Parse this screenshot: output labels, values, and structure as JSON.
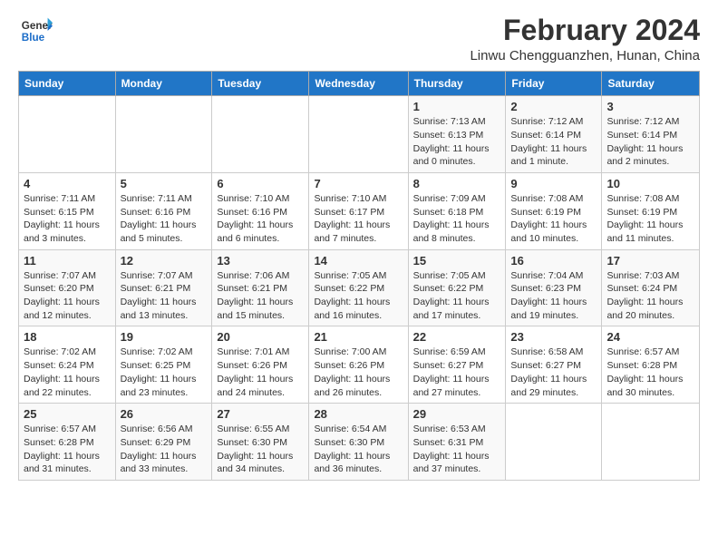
{
  "logo": {
    "text_general": "General",
    "text_blue": "Blue"
  },
  "header": {
    "title": "February 2024",
    "subtitle": "Linwu Chengguanzhen, Hunan, China"
  },
  "columns": [
    "Sunday",
    "Monday",
    "Tuesday",
    "Wednesday",
    "Thursday",
    "Friday",
    "Saturday"
  ],
  "weeks": [
    [
      {
        "day": "",
        "info": ""
      },
      {
        "day": "",
        "info": ""
      },
      {
        "day": "",
        "info": ""
      },
      {
        "day": "",
        "info": ""
      },
      {
        "day": "1",
        "info": "Sunrise: 7:13 AM\nSunset: 6:13 PM\nDaylight: 11 hours\nand 0 minutes."
      },
      {
        "day": "2",
        "info": "Sunrise: 7:12 AM\nSunset: 6:14 PM\nDaylight: 11 hours\nand 1 minute."
      },
      {
        "day": "3",
        "info": "Sunrise: 7:12 AM\nSunset: 6:14 PM\nDaylight: 11 hours\nand 2 minutes."
      }
    ],
    [
      {
        "day": "4",
        "info": "Sunrise: 7:11 AM\nSunset: 6:15 PM\nDaylight: 11 hours\nand 3 minutes."
      },
      {
        "day": "5",
        "info": "Sunrise: 7:11 AM\nSunset: 6:16 PM\nDaylight: 11 hours\nand 5 minutes."
      },
      {
        "day": "6",
        "info": "Sunrise: 7:10 AM\nSunset: 6:16 PM\nDaylight: 11 hours\nand 6 minutes."
      },
      {
        "day": "7",
        "info": "Sunrise: 7:10 AM\nSunset: 6:17 PM\nDaylight: 11 hours\nand 7 minutes."
      },
      {
        "day": "8",
        "info": "Sunrise: 7:09 AM\nSunset: 6:18 PM\nDaylight: 11 hours\nand 8 minutes."
      },
      {
        "day": "9",
        "info": "Sunrise: 7:08 AM\nSunset: 6:19 PM\nDaylight: 11 hours\nand 10 minutes."
      },
      {
        "day": "10",
        "info": "Sunrise: 7:08 AM\nSunset: 6:19 PM\nDaylight: 11 hours\nand 11 minutes."
      }
    ],
    [
      {
        "day": "11",
        "info": "Sunrise: 7:07 AM\nSunset: 6:20 PM\nDaylight: 11 hours\nand 12 minutes."
      },
      {
        "day": "12",
        "info": "Sunrise: 7:07 AM\nSunset: 6:21 PM\nDaylight: 11 hours\nand 13 minutes."
      },
      {
        "day": "13",
        "info": "Sunrise: 7:06 AM\nSunset: 6:21 PM\nDaylight: 11 hours\nand 15 minutes."
      },
      {
        "day": "14",
        "info": "Sunrise: 7:05 AM\nSunset: 6:22 PM\nDaylight: 11 hours\nand 16 minutes."
      },
      {
        "day": "15",
        "info": "Sunrise: 7:05 AM\nSunset: 6:22 PM\nDaylight: 11 hours\nand 17 minutes."
      },
      {
        "day": "16",
        "info": "Sunrise: 7:04 AM\nSunset: 6:23 PM\nDaylight: 11 hours\nand 19 minutes."
      },
      {
        "day": "17",
        "info": "Sunrise: 7:03 AM\nSunset: 6:24 PM\nDaylight: 11 hours\nand 20 minutes."
      }
    ],
    [
      {
        "day": "18",
        "info": "Sunrise: 7:02 AM\nSunset: 6:24 PM\nDaylight: 11 hours\nand 22 minutes."
      },
      {
        "day": "19",
        "info": "Sunrise: 7:02 AM\nSunset: 6:25 PM\nDaylight: 11 hours\nand 23 minutes."
      },
      {
        "day": "20",
        "info": "Sunrise: 7:01 AM\nSunset: 6:26 PM\nDaylight: 11 hours\nand 24 minutes."
      },
      {
        "day": "21",
        "info": "Sunrise: 7:00 AM\nSunset: 6:26 PM\nDaylight: 11 hours\nand 26 minutes."
      },
      {
        "day": "22",
        "info": "Sunrise: 6:59 AM\nSunset: 6:27 PM\nDaylight: 11 hours\nand 27 minutes."
      },
      {
        "day": "23",
        "info": "Sunrise: 6:58 AM\nSunset: 6:27 PM\nDaylight: 11 hours\nand 29 minutes."
      },
      {
        "day": "24",
        "info": "Sunrise: 6:57 AM\nSunset: 6:28 PM\nDaylight: 11 hours\nand 30 minutes."
      }
    ],
    [
      {
        "day": "25",
        "info": "Sunrise: 6:57 AM\nSunset: 6:28 PM\nDaylight: 11 hours\nand 31 minutes."
      },
      {
        "day": "26",
        "info": "Sunrise: 6:56 AM\nSunset: 6:29 PM\nDaylight: 11 hours\nand 33 minutes."
      },
      {
        "day": "27",
        "info": "Sunrise: 6:55 AM\nSunset: 6:30 PM\nDaylight: 11 hours\nand 34 minutes."
      },
      {
        "day": "28",
        "info": "Sunrise: 6:54 AM\nSunset: 6:30 PM\nDaylight: 11 hours\nand 36 minutes."
      },
      {
        "day": "29",
        "info": "Sunrise: 6:53 AM\nSunset: 6:31 PM\nDaylight: 11 hours\nand 37 minutes."
      },
      {
        "day": "",
        "info": ""
      },
      {
        "day": "",
        "info": ""
      }
    ]
  ]
}
